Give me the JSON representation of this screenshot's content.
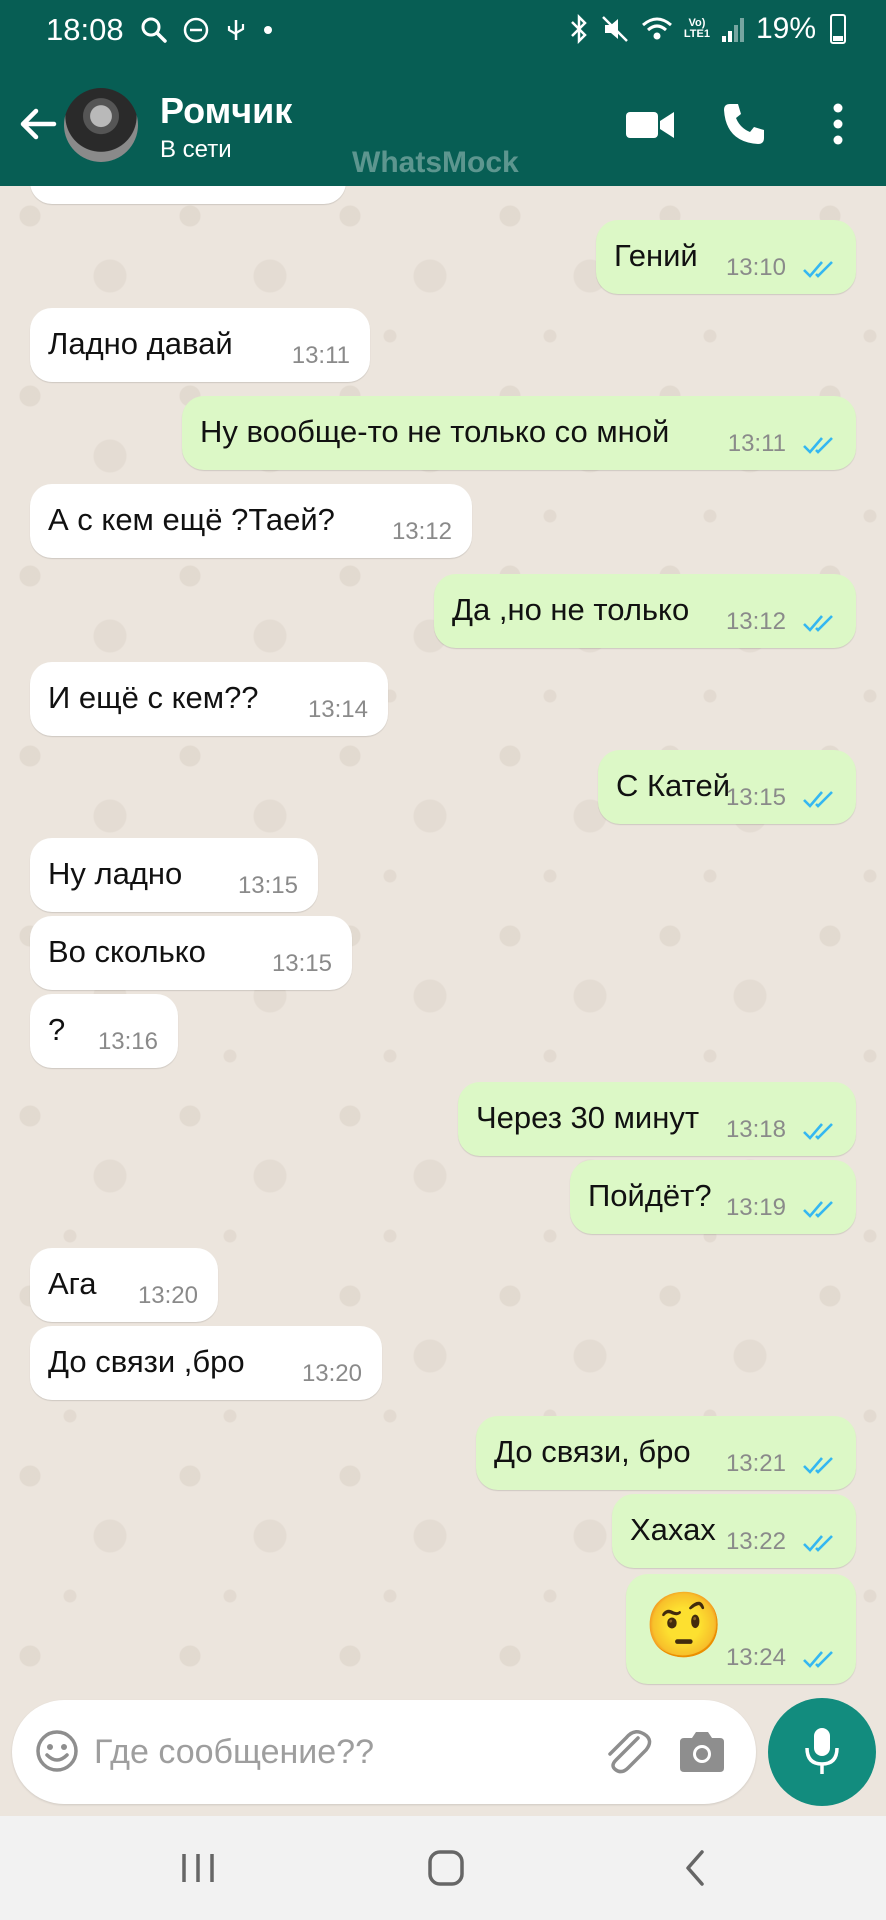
{
  "status_bar": {
    "time": "18:08",
    "lte_label_top": "Vo)",
    "lte_label_bottom": "LTE1",
    "battery": "19%"
  },
  "header": {
    "contact_name": "Ромчик",
    "contact_status": "В сети",
    "watermark": "WhatsMock"
  },
  "messages": [
    {
      "direction": "out",
      "text": "Гений",
      "time": "13:10",
      "read": true
    },
    {
      "direction": "in",
      "text": "Ладно давай",
      "time": "13:11"
    },
    {
      "direction": "out",
      "text": "Ну вообще-то не только со мной",
      "time": "13:11",
      "read": true
    },
    {
      "direction": "in",
      "text": "А с кем ещё ?Таей?",
      "time": "13:12"
    },
    {
      "direction": "out",
      "text": "Да ,но не только",
      "time": "13:12",
      "read": true
    },
    {
      "direction": "in",
      "text": "И ещё с кем??",
      "time": "13:14"
    },
    {
      "direction": "out",
      "text": "С Катей",
      "time": "13:15",
      "read": true
    },
    {
      "direction": "in",
      "text": "Ну ладно",
      "time": "13:15"
    },
    {
      "direction": "in",
      "text": "Во сколько",
      "time": "13:15"
    },
    {
      "direction": "in",
      "text": "?",
      "time": "13:16"
    },
    {
      "direction": "out",
      "text": "Через 30 минут",
      "time": "13:18",
      "read": true
    },
    {
      "direction": "out",
      "text": "Пойдёт?",
      "time": "13:19",
      "read": true
    },
    {
      "direction": "in",
      "text": "Ага",
      "time": "13:20"
    },
    {
      "direction": "in",
      "text": "До связи ,бро",
      "time": "13:20"
    },
    {
      "direction": "out",
      "text": "До связи,  бро",
      "time": "13:21",
      "read": true
    },
    {
      "direction": "out",
      "text": "Хахах",
      "time": "13:22",
      "read": true
    },
    {
      "direction": "out",
      "text": "🤨",
      "time": "13:24",
      "read": true,
      "emoji_only": true
    }
  ],
  "composer": {
    "placeholder": "Где сообщение??"
  },
  "icons": {
    "back": "arrow-left-icon",
    "video": "video-camera-icon",
    "call": "phone-icon",
    "menu": "more-vertical-icon",
    "emoji": "smiley-icon",
    "attach": "paperclip-icon",
    "camera": "camera-icon",
    "mic": "microphone-icon",
    "read": "double-check-icon"
  },
  "colors": {
    "header": "#075e54",
    "outgoing_bubble": "#dcf8c6",
    "incoming_bubble": "#ffffff",
    "chat_background": "#ece5dd",
    "mic_button": "#128c7e",
    "read_ticks": "#34b7f1"
  }
}
